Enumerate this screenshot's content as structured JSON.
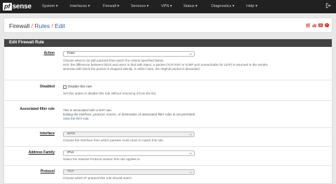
{
  "navbar": {
    "logo_prefix": "pf",
    "logo_suffix": "sense",
    "menu": [
      "System ▾",
      "Interfaces ▾",
      "Firewall ▾",
      "Services ▾",
      "VPN ▾",
      "Status ▾",
      "Diagnostics ▾",
      "Help ▾"
    ],
    "exit_icon": "logout-icon"
  },
  "breadcrumb": {
    "part1": "Firewall",
    "sep": "/",
    "part2": "Rules",
    "part3": "Edit",
    "icons": [
      "sliders-icon",
      "chart-icon",
      "list-icon",
      "help-icon"
    ]
  },
  "panel": {
    "title": "Edit Firewall Rule",
    "action": {
      "label": "Action",
      "value": "Pass",
      "help1": "Choose what to do with packets that match the criteria specified below.",
      "help2": "Hint: the difference between block and reject is that with reject, a packet (TCP RST or ICMP port unreachable for UDP) is returned to the sender,",
      "help3": "whereas with block the packet is dropped silently. In either case, the original packet is discarded."
    },
    "disabled": {
      "label": "Disabled",
      "checkbox": "Disable this rule",
      "help": "Set this option to disable this rule without removing it from the list."
    },
    "assoc": {
      "label": "Associated filter rule",
      "line1": "This is associated with a NAT rule.",
      "line2": "Editing the interface, protocol, source, or destination of associated filter rules is not permitted.",
      "link": "View the NAT rule"
    },
    "interface": {
      "label": "Interface",
      "value": "WAN",
      "help": "Choose the interface from which packets must come to match this rule."
    },
    "family": {
      "label": "Address Family",
      "value": "IPv4",
      "help": "Select the Internet Protocol version this rule applies to."
    },
    "protocol": {
      "label": "Protocol",
      "value": "TCP",
      "help": "Choose which IP protocol this rule should match."
    }
  },
  "colors": {
    "navbar": "#212121",
    "accent_orange": "#f05a28",
    "link_blue": "#2c6c9c",
    "panel_head": "#424242"
  }
}
